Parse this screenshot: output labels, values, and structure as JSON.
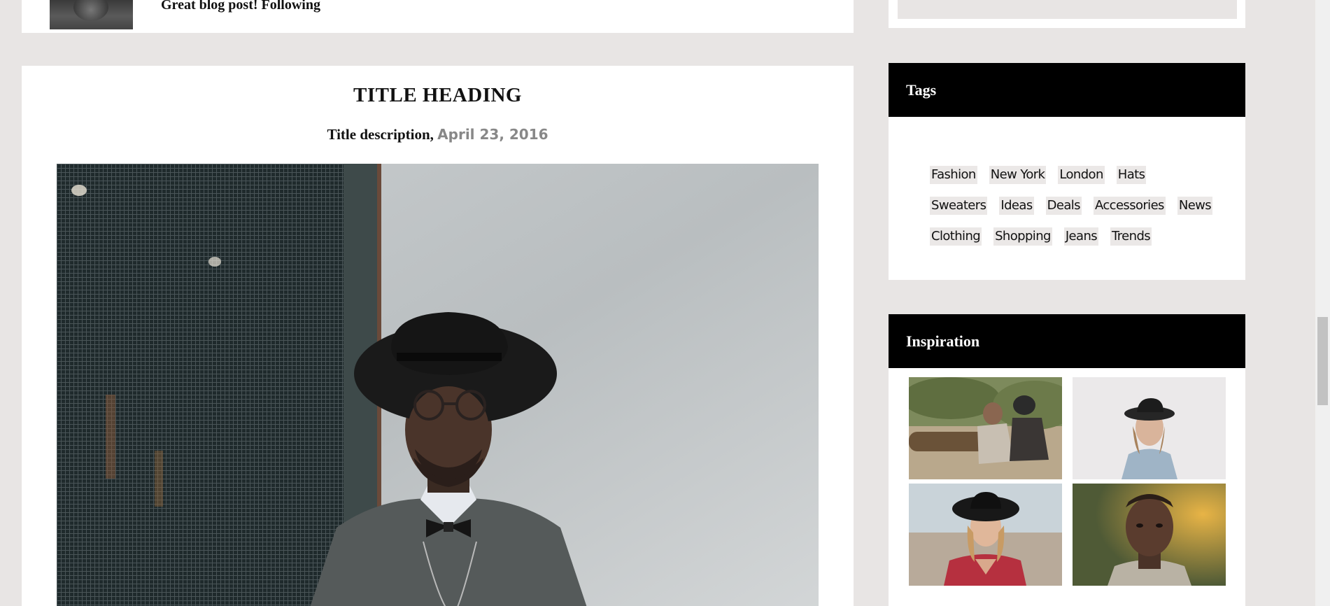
{
  "comment": {
    "text": "Great blog post! Following"
  },
  "post": {
    "title": "TITLE HEADING",
    "description": "Title description,",
    "date": "April 23, 2016"
  },
  "sidebar": {
    "tags": {
      "heading": "Tags",
      "rows": [
        [
          "Fashion",
          "New York",
          "London",
          "Hats"
        ],
        [
          "Sweaters",
          "Ideas",
          "Deals",
          "Accessories",
          "News"
        ],
        [
          "Clothing",
          "Shopping",
          "Jeans",
          "Trends"
        ]
      ]
    },
    "inspiration": {
      "heading": "Inspiration"
    }
  },
  "colors": {
    "page_bg": "#e8e5e4",
    "card_bg": "#ffffff",
    "widget_header_bg": "#000000",
    "tag_bg": "#ebe8e7",
    "date_text": "#888888"
  },
  "icons": [
    "avatar-thumbnail",
    "post-photo",
    "inspiration-photo"
  ]
}
